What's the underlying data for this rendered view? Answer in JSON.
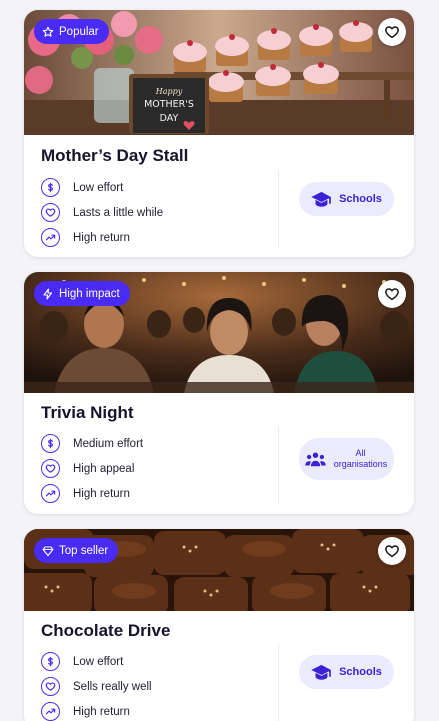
{
  "colors": {
    "accent": "#4a2bf5",
    "pill_bg": "#ecebfd",
    "card_bg": "#ffffff",
    "page_bg": "#f4f4f7"
  },
  "cards": [
    {
      "badge": {
        "label": "Popular",
        "icon": "star-icon"
      },
      "title": "Mother’s Day Stall",
      "image_sign": {
        "line1": "Happy",
        "line2": "MOTHER'S",
        "line3": "DAY"
      },
      "attributes": [
        {
          "icon": "dollar-icon",
          "label": "Low effort"
        },
        {
          "icon": "heart-icon",
          "label": "Lasts a little while"
        },
        {
          "icon": "trending-up-icon",
          "label": "High return"
        }
      ],
      "audience": {
        "icon": "graduation-cap-icon",
        "label": "Schools"
      }
    },
    {
      "badge": {
        "label": "High impact",
        "icon": "lightning-icon"
      },
      "title": "Trivia Night",
      "attributes": [
        {
          "icon": "dollar-icon",
          "label": "Medium effort"
        },
        {
          "icon": "heart-icon",
          "label": "High appeal"
        },
        {
          "icon": "trending-up-icon",
          "label": "High return"
        }
      ],
      "audience": {
        "icon": "people-icon",
        "label": "All organisations"
      }
    },
    {
      "badge": {
        "label": "Top seller",
        "icon": "diamond-icon"
      },
      "title": "Chocolate Drive",
      "attributes": [
        {
          "icon": "dollar-icon",
          "label": "Low effort"
        },
        {
          "icon": "heart-icon",
          "label": "Sells really well"
        },
        {
          "icon": "trending-up-icon",
          "label": "High return"
        }
      ],
      "audience": {
        "icon": "graduation-cap-icon",
        "label": "Schools"
      }
    }
  ]
}
